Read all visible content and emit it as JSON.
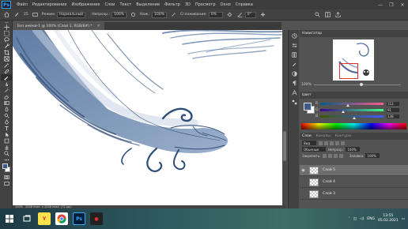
{
  "app": {
    "logo": "Ps",
    "menu": [
      "Файл",
      "Редактирование",
      "Изображение",
      "Слои",
      "Текст",
      "Выделение",
      "Фильтр",
      "3D",
      "Просмотр",
      "Окно",
      "Справка"
    ],
    "window_controls": [
      "—",
      "❐",
      "✕"
    ]
  },
  "options": {
    "brush_size": "25",
    "mode_label": "Режим:",
    "mode_value": "Нормальный",
    "opacity_label": "Непрозр.:",
    "opacity_value": "100%",
    "flow_label": "Наж.:",
    "flow_value": "100%",
    "smoothing_label": "Сглаживание:",
    "smoothing_value": "0%",
    "angle_value": "0°"
  },
  "document": {
    "tab_title": "Без имени-1 @ 100% (Слой 1, RGB/8#) *",
    "zoom": "100%",
    "doc_size": "2048 пикс. x 2048 пикс. (72 ppi)"
  },
  "navigator": {
    "title": "Навигатор",
    "zoom": "100%"
  },
  "color": {
    "title": "Цвет",
    "fg_color": "#3c5b8a",
    "bg_color": "#ffffff",
    "channels": [
      {
        "label": "R",
        "value": "112",
        "fraction": 0.44
      },
      {
        "label": "G",
        "value": "91",
        "fraction": 0.36
      },
      {
        "label": "B",
        "value": "138",
        "fraction": 0.54
      }
    ]
  },
  "layers": {
    "tabs": [
      "Слои",
      "Каналы",
      "Контуры"
    ],
    "kind_label": "Вид",
    "blend_mode": "Обычные",
    "opacity_label": "Непрозр.:",
    "opacity_value": "100%",
    "lock_label": "Закрепить:",
    "fill_label": "Заливка:",
    "fill_value": "100%",
    "items": [
      {
        "name": "Слой 5",
        "active": true
      },
      {
        "name": "Слой 4",
        "active": false
      },
      {
        "name": "Слой 3",
        "active": false
      }
    ]
  },
  "taskbar": {
    "apps": [
      "⊞",
      "☰",
      "Y",
      "G",
      "Ps",
      "●"
    ],
    "lang": "ENG",
    "time": "13:55",
    "date": "05.02.2021"
  }
}
